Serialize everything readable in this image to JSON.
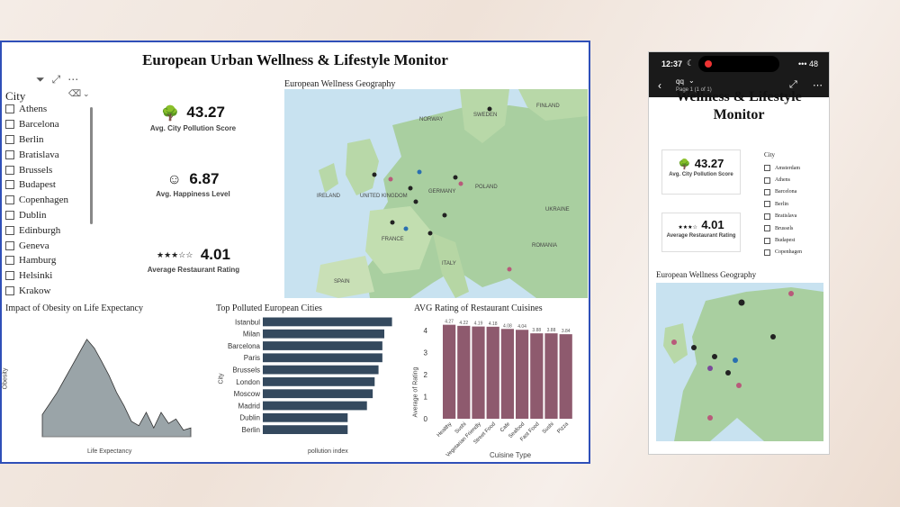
{
  "dashboard": {
    "title": "European Urban Wellness & Lifestyle Monitor",
    "slicer": {
      "title": "City",
      "items": [
        "Athens",
        "Barcelona",
        "Berlin",
        "Bratislava",
        "Brussels",
        "Budapest",
        "Copenhagen",
        "Dublin",
        "Edinburgh",
        "Geneva",
        "Hamburg",
        "Helsinki",
        "Krakow"
      ]
    },
    "kpis": [
      {
        "value": "43.27",
        "label": "Avg. City Pollution Score",
        "icon": "trees-icon"
      },
      {
        "value": "6.87",
        "label": "Avg. Happiness Level",
        "icon": "smile-icon"
      },
      {
        "value": "4.01",
        "label": "Average Restaurant Rating",
        "icon": "stars-icon"
      }
    ],
    "map": {
      "title": "European Wellness Geography",
      "labels": [
        "UNITED KINGDOM",
        "IRELAND",
        "GERMANY",
        "FRANCE",
        "SPAIN",
        "ITALY",
        "POLAND",
        "UKRAINE",
        "ROMANIA",
        "NORWAY",
        "SWEDEN",
        "FINLAND"
      ]
    },
    "obesity_chart": {
      "title": "Impact of Obesity on Life Expectancy",
      "xlabel": "Life Expectancy",
      "ylabel": "Obesity"
    },
    "polluted_chart": {
      "title": "Top Polluted European Cities",
      "xlabel": "pollution index",
      "ylabel": "City"
    },
    "cuisine_chart": {
      "title": "AVG Rating of Restaurant Cuisines",
      "xlabel": "Cuisine Type",
      "ylabel": "Average of Rating"
    }
  },
  "phone": {
    "time": "12:37",
    "status_icons": "••• 48",
    "app": "qq",
    "page": "Page 1 (1 of 1)",
    "title_line1": "Wellness & Lifestyle",
    "title_line2": "Monitor",
    "kpis": [
      {
        "value": "43.27",
        "label": "Avg. City Pollution Score"
      },
      {
        "value": "4.01",
        "label": "Average Restaurant Rating"
      }
    ],
    "slicer_title": "City",
    "slicer_items": [
      "Amsterdam",
      "Athens",
      "Barcelona",
      "Berlin",
      "Bratislava",
      "Brussels",
      "Budapest",
      "Copenhagen"
    ],
    "map_title": "European Wellness Geography"
  },
  "chart_data": [
    {
      "type": "bar",
      "title": "Top Polluted European Cities",
      "categories": [
        "Istanbul",
        "Milan",
        "Barcelona",
        "Paris",
        "Brussels",
        "London",
        "Moscow",
        "Madrid",
        "Dublin",
        "Berlin"
      ],
      "values": [
        67,
        63,
        62,
        62,
        60,
        58,
        57,
        54,
        44,
        44
      ],
      "xlabel": "pollution index",
      "ylabel": "City",
      "orientation": "horizontal",
      "color": "#34495e"
    },
    {
      "type": "bar",
      "title": "AVG Rating of Restaurant Cuisines",
      "categories": [
        "Healthy",
        "Sushi",
        "Vegetarian Friendly",
        "Street Food",
        "Cafe",
        "Seafood",
        "Fast Food",
        "Sushi",
        "Pizza"
      ],
      "values": [
        4.27,
        4.22,
        4.19,
        4.18,
        4.08,
        4.04,
        3.88,
        3.88,
        3.84
      ],
      "xlabel": "Cuisine Type",
      "ylabel": "Average of Rating",
      "ylim": [
        0,
        4.5
      ],
      "color": "#8e5a6e"
    },
    {
      "type": "area",
      "title": "Impact of Obesity on Life Expectancy",
      "x": [
        0,
        1,
        2,
        3,
        4,
        5,
        6,
        7,
        8,
        9,
        10,
        11,
        12,
        13,
        14,
        15,
        16,
        17,
        18,
        19,
        20
      ],
      "values": [
        20,
        30,
        40,
        52,
        64,
        76,
        88,
        80,
        68,
        55,
        40,
        28,
        14,
        10,
        22,
        8,
        22,
        12,
        16,
        6,
        8
      ],
      "xlabel": "Life Expectancy",
      "ylabel": "Obesity",
      "color": "#9aa4a8"
    }
  ]
}
